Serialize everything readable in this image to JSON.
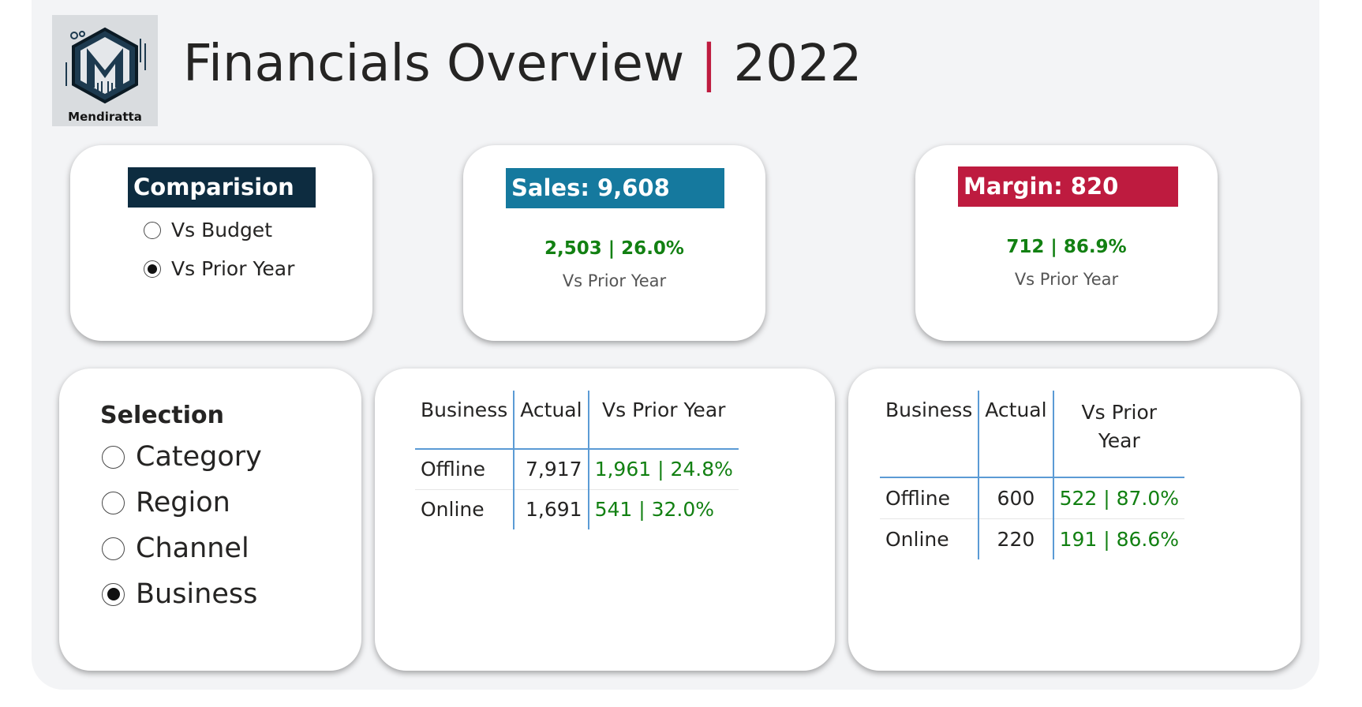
{
  "header": {
    "title": "Financials Overview",
    "separator": "|",
    "year": "2022",
    "logo_text": "Mendiratta"
  },
  "colors": {
    "comparison_banner": "#0d2c40",
    "sales_banner": "#15799e",
    "margin_banner": "#be1b3f",
    "positive": "#128012",
    "grid_line": "#5b9bd5"
  },
  "comparison": {
    "title": "Comparision",
    "options": [
      {
        "label": "Vs Budget",
        "checked": false
      },
      {
        "label": "Vs Prior Year",
        "checked": true
      }
    ]
  },
  "sales_kpi": {
    "banner": "Sales: 9,608",
    "value": "2,503 |  26.0%",
    "subtitle": "Vs Prior Year"
  },
  "margin_kpi": {
    "banner": "Margin: 820",
    "value": "712 |  86.9%",
    "subtitle": "Vs Prior Year"
  },
  "selection": {
    "title": "Selection",
    "options": [
      {
        "label": "Category",
        "checked": false
      },
      {
        "label": "Region",
        "checked": false
      },
      {
        "label": "Channel",
        "checked": false
      },
      {
        "label": "Business",
        "checked": true
      }
    ]
  },
  "sales_table": {
    "headers": [
      "Business",
      "Actual",
      "Vs Prior Year"
    ],
    "rows": [
      [
        "Offline",
        "7,917",
        "1,961 | 24.8%"
      ],
      [
        "Online",
        "1,691",
        "541 | 32.0%"
      ]
    ]
  },
  "margin_table": {
    "headers": [
      "Business",
      "Actual",
      "Vs Prior Year"
    ],
    "rows": [
      [
        "Offline",
        "600",
        "522 | 87.0%"
      ],
      [
        "Online",
        "220",
        "191 | 86.6%"
      ]
    ]
  }
}
